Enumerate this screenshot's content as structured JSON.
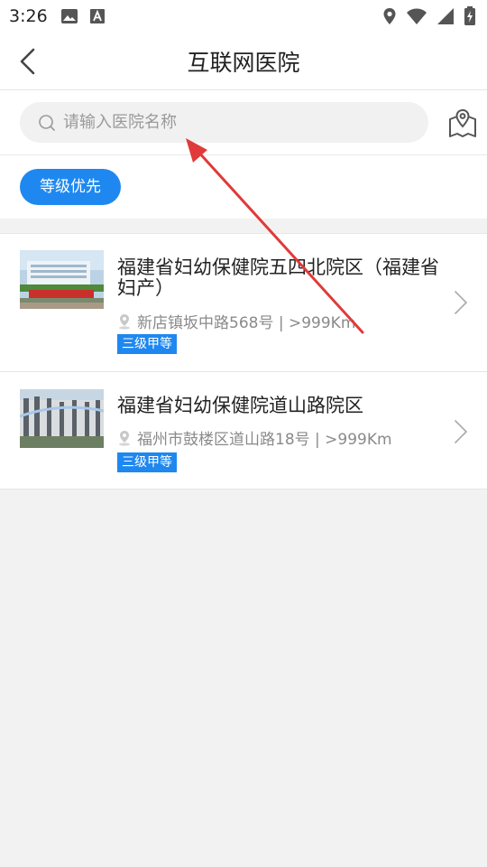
{
  "status_bar": {
    "time": "3:26"
  },
  "header": {
    "title": "互联网医院"
  },
  "search": {
    "placeholder": "请输入医院名称",
    "value": ""
  },
  "filter": {
    "chip_label": "等级优先"
  },
  "hospitals": [
    {
      "name": "福建省妇幼保健院五四北院区（福建省妇产）",
      "address": "新店镇坂中路568号 | >999Km",
      "level": "三级甲等"
    },
    {
      "name": "福建省妇幼保健院道山路院区",
      "address": "福州市鼓楼区道山路18号 | >999Km",
      "level": "三级甲等"
    }
  ],
  "colors": {
    "accent": "#1e88f0",
    "annotation_arrow": "#e03a3a",
    "background": "#f2f2f2"
  },
  "icons": [
    "image-icon",
    "accessibility-a-icon",
    "location-icon",
    "wifi-icon",
    "signal-icon",
    "battery-icon",
    "back-arrow-icon",
    "search-icon",
    "map-location-icon",
    "pin-icon",
    "chevron-right-icon"
  ]
}
